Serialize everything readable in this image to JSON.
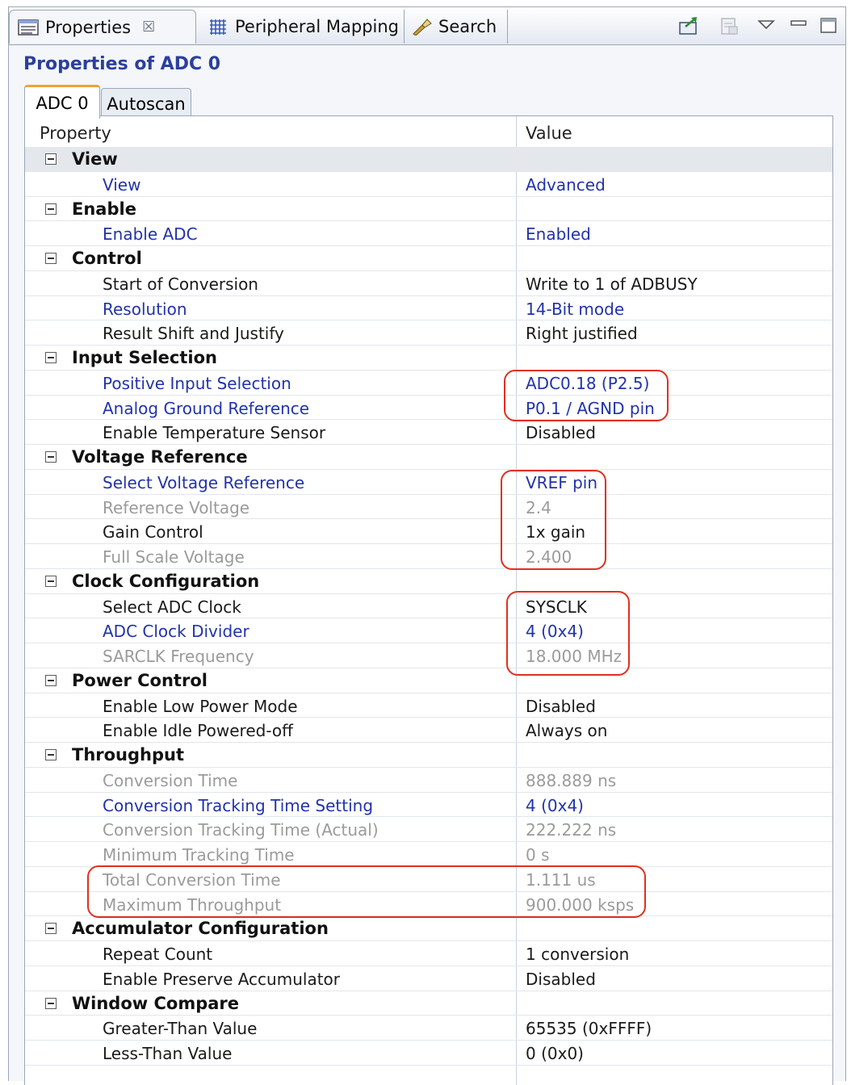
{
  "view_tabs": [
    {
      "label": "Properties",
      "close": "☒"
    },
    {
      "label": "Peripheral Mapping"
    },
    {
      "label": "Search"
    }
  ],
  "title": "Properties of ADC 0",
  "inner_tabs": [
    "ADC 0",
    "Autoscan"
  ],
  "columns": {
    "property": "Property",
    "value": "Value"
  },
  "rows": [
    {
      "type": "group",
      "name": "View"
    },
    {
      "type": "prop",
      "name": "View",
      "value": "Advanced",
      "style": "blue"
    },
    {
      "type": "group",
      "name": "Enable"
    },
    {
      "type": "prop",
      "name": "Enable ADC",
      "value": "Enabled",
      "style": "blue"
    },
    {
      "type": "group",
      "name": "Control"
    },
    {
      "type": "prop",
      "name": "Start of Conversion",
      "value": "Write to 1 of ADBUSY",
      "style": "black"
    },
    {
      "type": "prop",
      "name": "Resolution",
      "value": "14-Bit mode",
      "style": "blue"
    },
    {
      "type": "prop",
      "name": "Result Shift and Justify",
      "value": "Right justified",
      "style": "black"
    },
    {
      "type": "group",
      "name": "Input Selection"
    },
    {
      "type": "prop",
      "name": "Positive Input Selection",
      "value": "ADC0.18 (P2.5)",
      "style": "blue"
    },
    {
      "type": "prop",
      "name": "Analog Ground Reference",
      "value": "P0.1 / AGND pin",
      "style": "blue"
    },
    {
      "type": "prop",
      "name": "Enable Temperature Sensor",
      "value": "Disabled",
      "style": "black"
    },
    {
      "type": "group",
      "name": "Voltage Reference"
    },
    {
      "type": "prop",
      "name": "Select Voltage Reference",
      "value": "VREF pin",
      "style": "blue"
    },
    {
      "type": "prop",
      "name": "Reference Voltage",
      "value": "2.4",
      "style": "gray"
    },
    {
      "type": "prop",
      "name": "Gain Control",
      "value": "1x gain",
      "style": "black"
    },
    {
      "type": "prop",
      "name": "Full Scale Voltage",
      "value": "2.400",
      "style": "gray"
    },
    {
      "type": "group",
      "name": "Clock Configuration"
    },
    {
      "type": "prop",
      "name": "Select ADC Clock",
      "value": "SYSCLK",
      "style": "black"
    },
    {
      "type": "prop",
      "name": "ADC Clock Divider",
      "value": "4 (0x4)",
      "style": "blue"
    },
    {
      "type": "prop",
      "name": "SARCLK Frequency",
      "value": "18.000 MHz",
      "style": "gray"
    },
    {
      "type": "group",
      "name": "Power Control"
    },
    {
      "type": "prop",
      "name": "Enable Low Power Mode",
      "value": "Disabled",
      "style": "black"
    },
    {
      "type": "prop",
      "name": "Enable Idle Powered-off",
      "value": "Always on",
      "style": "black"
    },
    {
      "type": "group",
      "name": "Throughput"
    },
    {
      "type": "prop",
      "name": "Conversion Time",
      "value": "888.889 ns",
      "style": "gray"
    },
    {
      "type": "prop",
      "name": "Conversion Tracking Time Setting",
      "value": "4 (0x4)",
      "style": "blue"
    },
    {
      "type": "prop",
      "name": "Conversion Tracking Time (Actual)",
      "value": "222.222 ns",
      "style": "gray"
    },
    {
      "type": "prop",
      "name": "Minimum Tracking Time",
      "value": "0 s",
      "style": "gray"
    },
    {
      "type": "prop",
      "name": "Total Conversion Time",
      "value": "1.111 us",
      "style": "gray"
    },
    {
      "type": "prop",
      "name": "Maximum Throughput",
      "value": "900.000 ksps",
      "style": "gray"
    },
    {
      "type": "group",
      "name": "Accumulator Configuration"
    },
    {
      "type": "prop",
      "name": "Repeat Count",
      "value": "1 conversion",
      "style": "black"
    },
    {
      "type": "prop",
      "name": "Enable Preserve Accumulator",
      "value": "Disabled",
      "style": "black"
    },
    {
      "type": "group",
      "name": "Window Compare"
    },
    {
      "type": "prop",
      "name": "Greater-Than Value",
      "value": "65535 (0xFFFF)",
      "style": "black"
    },
    {
      "type": "prop",
      "name": "Less-Than Value",
      "value": "0 (0x0)",
      "style": "black"
    }
  ],
  "colors": {
    "blue_value": "#2233aa",
    "gray_value": "#9b9b9b",
    "title": "#2b3f9e",
    "highlight": "#e0301e",
    "active_tab_accent": "#f0a33a"
  },
  "icons": [
    "properties-view-icon",
    "grid-icon",
    "flashlight-icon",
    "export-icon",
    "disabled-page-icon",
    "view-menu-icon",
    "minimize-icon",
    "maximize-icon",
    "collapse-icon"
  ]
}
